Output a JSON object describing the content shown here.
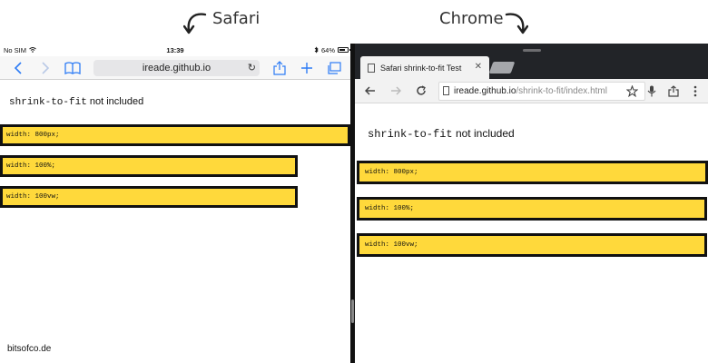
{
  "captions": {
    "safari": "Safari",
    "chrome": "Chrome"
  },
  "safari": {
    "status": {
      "carrier": "No SIM",
      "wifi": "wifi-icon",
      "time": "13:39",
      "bluetooth": "bluetooth-icon",
      "battery_pct": "64%"
    },
    "address": "ireade.github.io",
    "heading_code": "shrink-to-fit",
    "heading_text": " not included",
    "bars": [
      "width: 800px;",
      "width: 100%;",
      "width: 100vw;"
    ]
  },
  "chrome": {
    "tab_title": "Safari shrink-to-fit Test",
    "url_host": "ireade.github.io",
    "url_path": "/shrink-to-fit/index.html",
    "heading_code": "shrink-to-fit",
    "heading_text": " not included",
    "bars": [
      "width: 800px;",
      "width: 100%;",
      "width: 100vw;"
    ]
  },
  "footer": "bitsofco.de",
  "colors": {
    "bar_fill": "#ffd93b",
    "safari_accent": "#2d7cf6",
    "chrome_tabstrip": "#222428"
  }
}
